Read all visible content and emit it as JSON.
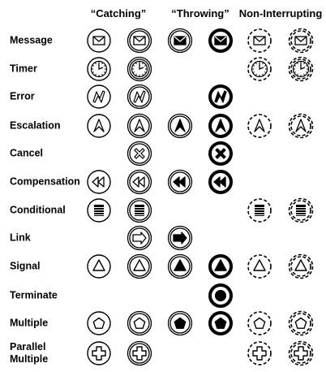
{
  "headers": {
    "catching": "“Catching”",
    "throwing": "“Throwing”",
    "non_interrupting": "Non-Interrupting"
  },
  "columns": [
    "start",
    "intermediate-catch",
    "intermediate-throw",
    "end",
    "start-non-interrupting",
    "intermediate-non-interrupting"
  ],
  "rows": [
    {
      "label": "Message",
      "marker": "envelope",
      "cells": [
        1,
        1,
        1,
        1,
        1,
        1
      ]
    },
    {
      "label": "Timer",
      "marker": "clock",
      "cells": [
        1,
        1,
        0,
        0,
        1,
        1
      ]
    },
    {
      "label": "Error",
      "marker": "lightning",
      "cells": [
        1,
        1,
        0,
        1,
        0,
        0
      ]
    },
    {
      "label": "Escalation",
      "marker": "escalation-arrow",
      "cells": [
        1,
        1,
        1,
        1,
        1,
        1
      ]
    },
    {
      "label": "Cancel",
      "marker": "x-cross",
      "cells": [
        0,
        1,
        0,
        1,
        0,
        0
      ]
    },
    {
      "label": "Compensation",
      "marker": "rewind",
      "cells": [
        1,
        1,
        1,
        1,
        0,
        0
      ]
    },
    {
      "label": "Conditional",
      "marker": "lines",
      "cells": [
        1,
        1,
        0,
        0,
        1,
        1
      ]
    },
    {
      "label": "Link",
      "marker": "arrow-right",
      "cells": [
        0,
        1,
        1,
        0,
        0,
        0
      ]
    },
    {
      "label": "Signal",
      "marker": "triangle",
      "cells": [
        1,
        1,
        1,
        1,
        1,
        1
      ]
    },
    {
      "label": "Terminate",
      "marker": "dot",
      "cells": [
        0,
        0,
        0,
        1,
        0,
        0
      ]
    },
    {
      "label": "Multiple",
      "marker": "pentagon",
      "cells": [
        1,
        1,
        1,
        1,
        1,
        1
      ]
    },
    {
      "label": "Parallel\nMultiple",
      "label_lines": [
        "Parallel",
        "Multiple"
      ],
      "marker": "plus",
      "cells": [
        1,
        1,
        0,
        0,
        1,
        1
      ]
    }
  ]
}
